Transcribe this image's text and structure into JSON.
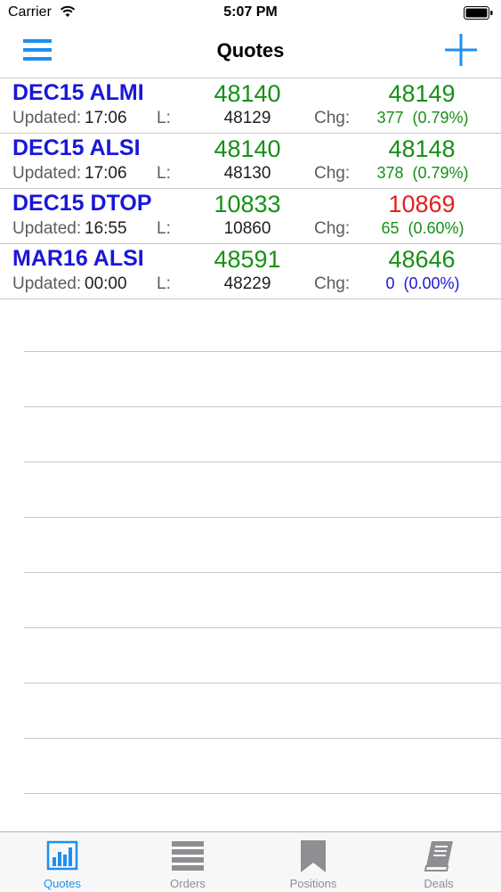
{
  "status_bar": {
    "carrier": "Carrier",
    "time": "5:07 PM",
    "icons": [
      "wifi-icon",
      "battery-icon"
    ]
  },
  "nav": {
    "title": "Quotes",
    "left_icon": "menu-icon",
    "right_icon": "plus-icon"
  },
  "labels": {
    "updated": "Updated:",
    "last": "L:",
    "change": "Chg:"
  },
  "quotes": [
    {
      "symbol": "DEC15 ALMI",
      "bid": "48140",
      "ask": "48149",
      "ask_color": "#169016",
      "updated": "17:06",
      "last": "48129",
      "change": "377  (0.79%)",
      "change_color": "#169016"
    },
    {
      "symbol": "DEC15 ALSI",
      "bid": "48140",
      "ask": "48148",
      "ask_color": "#169016",
      "updated": "17:06",
      "last": "48130",
      "change": "378  (0.79%)",
      "change_color": "#169016"
    },
    {
      "symbol": "DEC15 DTOP",
      "bid": "10833",
      "ask": "10869",
      "ask_color": "#e21f1f",
      "updated": "16:55",
      "last": "10860",
      "change": "65  (0.60%)",
      "change_color": "#169016"
    },
    {
      "symbol": "MAR16 ALSI",
      "bid": "48591",
      "ask": "48646",
      "ask_color": "#169016",
      "updated": "00:00",
      "last": "48229",
      "change": "0  (0.00%)",
      "change_color": "#1a17d8"
    }
  ],
  "colors": {
    "symbol": "#1a17d8",
    "bid": "#169016",
    "accent": "#1e8ff2",
    "tab_inactive": "#8e8e93"
  },
  "tabs": [
    {
      "label": "Quotes",
      "icon": "bar-chart-icon",
      "active": true
    },
    {
      "label": "Orders",
      "icon": "list-icon",
      "active": false
    },
    {
      "label": "Positions",
      "icon": "bookmark-icon",
      "active": false
    },
    {
      "label": "Deals",
      "icon": "book-icon",
      "active": false
    }
  ]
}
